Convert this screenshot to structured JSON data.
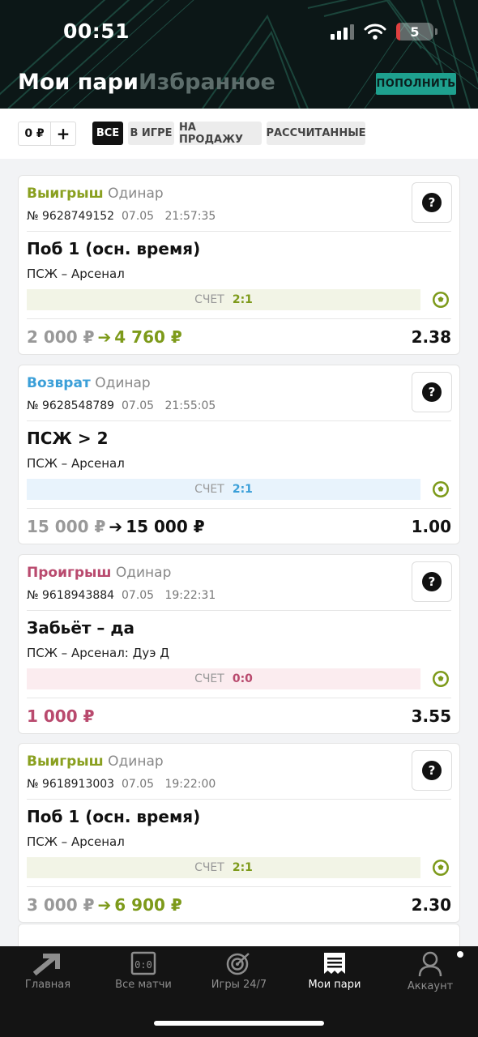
{
  "status_bar": {
    "time": "00:51",
    "battery": "5"
  },
  "header": {
    "title": "Мои пари",
    "tab_favorites": "Избранное",
    "topup_label": "ПОПОЛНИТЬ"
  },
  "filters": {
    "balance": "0 ₽",
    "add": "+",
    "chips": [
      "ВСЕ",
      "В ИГРЕ",
      "НА ПРОДАЖУ",
      "РАССЧИТАННЫЕ"
    ],
    "active": "ВСЕ"
  },
  "score_label": "СЧЕТ",
  "bets": [
    {
      "result": "Выигрыш",
      "bet_type": "Одинар",
      "number": "№ 9628749152",
      "date": "07.05",
      "time": "21:57:35",
      "event": "Поб 1 (осн. время)",
      "match": "ПСЖ – Арсенал",
      "score": "2:1",
      "stake": "2 000 ₽",
      "arrow": "➔",
      "payout": "4 760 ₽",
      "odds": "2.38"
    },
    {
      "result": "Возврат",
      "bet_type": "Одинар",
      "number": "№ 9628548789",
      "date": "07.05",
      "time": "21:55:05",
      "event": "ПСЖ > 2",
      "match": "ПСЖ – Арсенал",
      "score": "2:1",
      "stake": "15 000 ₽",
      "arrow": "➔",
      "payout": "15 000 ₽",
      "odds": "1.00"
    },
    {
      "result": "Проигрыш",
      "bet_type": "Одинар",
      "number": "№ 9618943884",
      "date": "07.05",
      "time": "19:22:31",
      "event": "Забьёт – да",
      "match": "ПСЖ – Арсенал: Дуэ Д",
      "score": "0:0",
      "stake": "1 000 ₽",
      "arrow": "",
      "payout": "",
      "odds": "3.55"
    },
    {
      "result": "Выигрыш",
      "bet_type": "Одинар",
      "number": "№ 9618913003",
      "date": "07.05",
      "time": "19:22:00",
      "event": "Поб 1 (осн. время)",
      "match": "ПСЖ – Арсенал",
      "score": "2:1",
      "stake": "3 000 ₽",
      "arrow": "➔",
      "payout": "6 900 ₽",
      "odds": "2.30"
    }
  ],
  "tabbar": {
    "items": [
      "Главная",
      "Все матчи",
      "Игры 24/7",
      "Мои пари",
      "Аккаунт"
    ],
    "active": "Мои пари"
  },
  "colors": {
    "win": "#8aa020",
    "refund": "#3b9fd8",
    "lose": "#b94a6e",
    "accent": "#1ea08e"
  }
}
